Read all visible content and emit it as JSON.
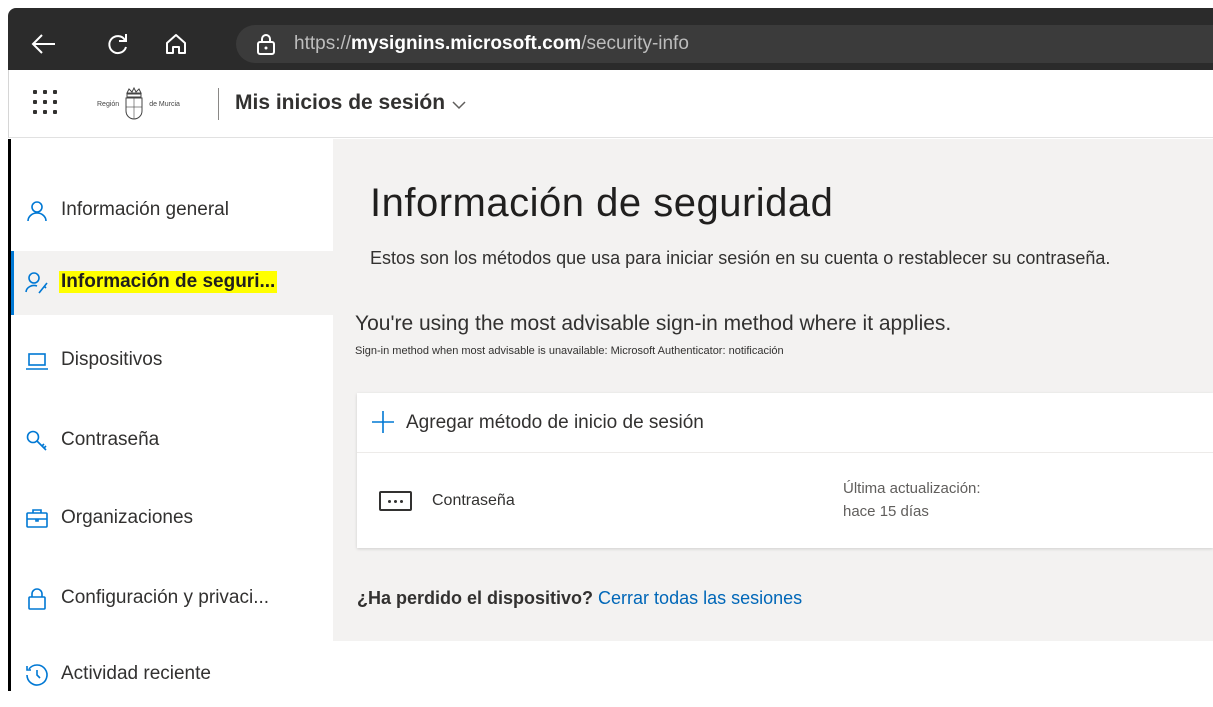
{
  "browser": {
    "url_prefix": "https://",
    "url_host": "mysignins.microsoft.com",
    "url_path": "/security-info"
  },
  "header": {
    "logo_left": "Región",
    "logo_right": "de Murcia",
    "app_title": "Mis inicios de sesión"
  },
  "sidebar": {
    "items": [
      {
        "label": "Información general",
        "icon": "person-icon"
      },
      {
        "label": "Información de seguri...",
        "icon": "person-key-icon",
        "active": true
      },
      {
        "label": "Dispositivos",
        "icon": "laptop-icon"
      },
      {
        "label": "Contraseña",
        "icon": "key-icon"
      },
      {
        "label": "Organizaciones",
        "icon": "briefcase-icon"
      },
      {
        "label": "Configuración y privaci...",
        "icon": "lock-icon"
      },
      {
        "label": "Actividad reciente",
        "icon": "history-icon"
      }
    ]
  },
  "main": {
    "title": "Información de seguridad",
    "subtitle": "Estos son los métodos que usa para iniciar sesión en su cuenta o restablecer su contraseña.",
    "advice_title": "You're using the most advisable sign-in method where it applies.",
    "advice_note": "Sign-in method when most advisable is unavailable: Microsoft Authenticator: notificación",
    "add_method_label": "Agregar método de inicio de sesión",
    "methods": [
      {
        "name": "Contraseña",
        "updated_label": "Última actualización:",
        "updated_value": "hace 15 días"
      }
    ],
    "lost_device_question": "¿Ha perdido el dispositivo?",
    "lost_device_link": "Cerrar todas las sesiones"
  },
  "colors": {
    "accent": "#0078d4",
    "link": "#0067b8",
    "highlight": "#ffff00",
    "browser_chrome": "#2b2b2b"
  }
}
